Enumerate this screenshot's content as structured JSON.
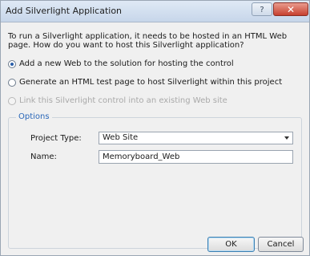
{
  "window": {
    "title": "Add Silverlight Application",
    "help_glyph": "?",
    "close_glyph": "✕"
  },
  "intro_text": "To run a Silverlight application, it needs to be hosted in an HTML Web page. How do you want to host this Silverlight application?",
  "options": [
    {
      "label": "Add a new Web to the solution for hosting the control",
      "checked": true,
      "enabled": true
    },
    {
      "label": "Generate an HTML test page to host Silverlight within this project",
      "checked": false,
      "enabled": true
    },
    {
      "label": "Link this Silverlight control into an existing Web site",
      "checked": false,
      "enabled": false
    }
  ],
  "group": {
    "legend": "Options",
    "project_type_label": "Project Type:",
    "project_type_value": "Web Site",
    "name_label": "Name:",
    "name_value": "Memoryboard_Web"
  },
  "buttons": {
    "ok": "OK",
    "cancel": "Cancel"
  }
}
